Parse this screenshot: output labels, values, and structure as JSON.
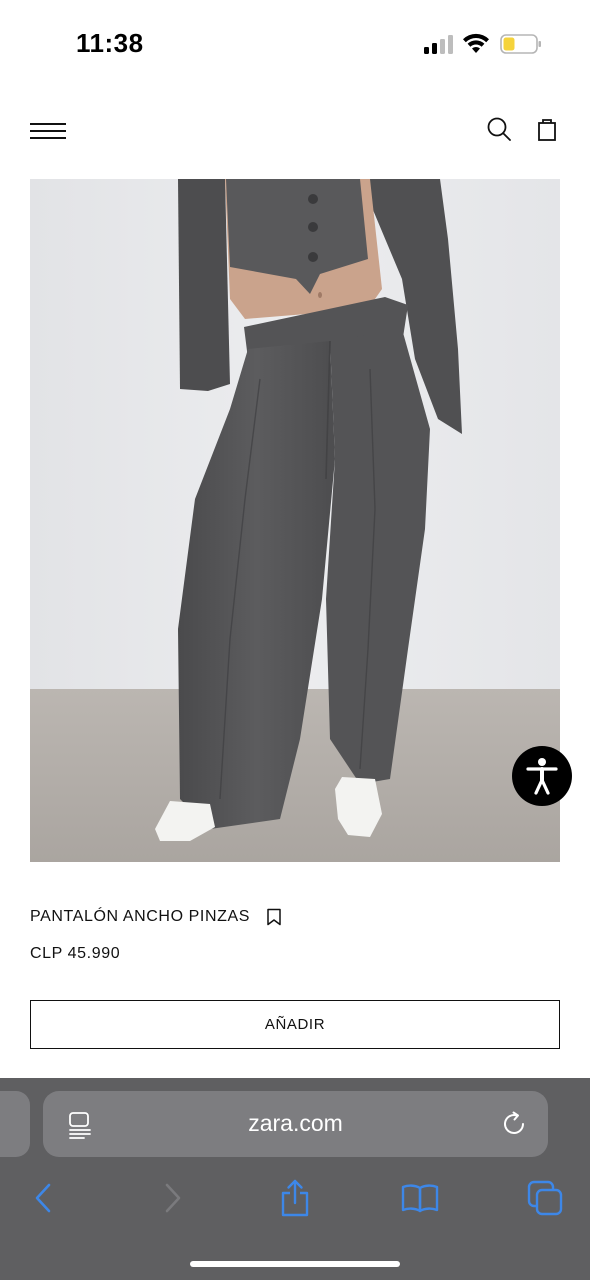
{
  "status_bar": {
    "time": "11:38",
    "icons": [
      "cellular-signal-icon",
      "wifi-icon",
      "battery-low-icon"
    ],
    "battery_color": "#f5d33b"
  },
  "header": {
    "icons": [
      "hamburger-menu-icon",
      "search-icon",
      "shopping-bag-icon"
    ]
  },
  "product": {
    "image_alt": "Pantalón ancho pinzas gris",
    "name": "PANTALÓN ANCHO PINZAS",
    "price": "CLP 45.990",
    "add_button_label": "AÑADIR",
    "bookmark_icon": "bookmark-icon"
  },
  "accessibility": {
    "icon": "accessibility-icon"
  },
  "browser": {
    "url": "zara.com",
    "accent_color": "#3d87e8",
    "toolbar_icons": [
      "back-icon",
      "forward-icon",
      "share-icon",
      "bookmarks-icon",
      "tabs-icon"
    ],
    "address_icons": [
      "reader-mode-icon",
      "reload-icon"
    ]
  }
}
